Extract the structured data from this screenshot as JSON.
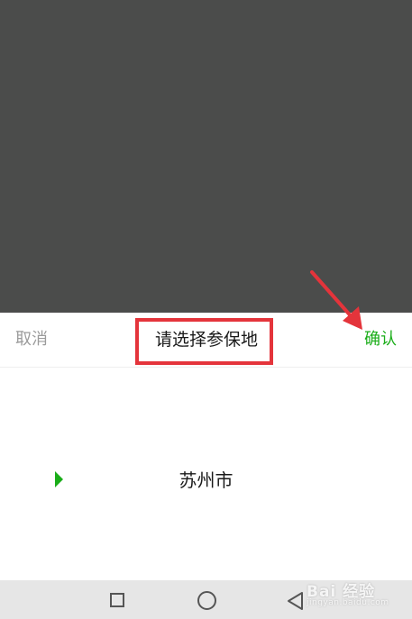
{
  "header": {
    "cancel_label": "取消",
    "title": "请选择参保地",
    "confirm_label": "确认"
  },
  "picker": {
    "selected_value": "苏州市"
  },
  "watermark": {
    "text": "Bai 经验",
    "sub": "jingyan.baidu.com"
  },
  "colors": {
    "overlay": "#4b4c4b",
    "accent_green": "#1aad19",
    "highlight_red": "#e4343b",
    "cancel_gray": "#9b9b9b"
  },
  "icons": {
    "nav_recent": "square-icon",
    "nav_home": "circle-icon",
    "nav_back": "triangle-back-icon",
    "annotation": "red-arrow-icon"
  }
}
